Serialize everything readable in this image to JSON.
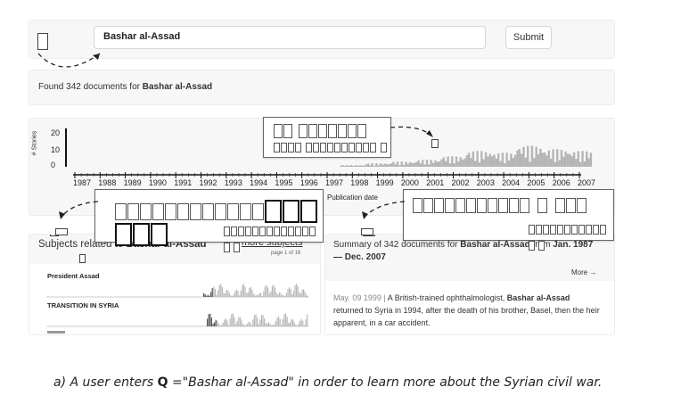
{
  "search": {
    "query": "Bashar al-Assad",
    "submit_label": "Submit"
  },
  "found": {
    "prefix": "Found 342 documents for ",
    "query": "Bashar al-Assad"
  },
  "timeline": {
    "y_label": "# Stories",
    "y_ticks": [
      "20",
      "10",
      "0"
    ],
    "x_label": "Publication date"
  },
  "chart_data": {
    "type": "area",
    "ylabel": "# Stories",
    "xlabel": "Publication date",
    "x": [
      "1987",
      "1988",
      "1989",
      "1990",
      "1991",
      "1992",
      "1993",
      "1994",
      "1995",
      "1996",
      "1997",
      "1998",
      "1999",
      "2000",
      "2001",
      "2002",
      "2003",
      "2004",
      "2005",
      "2006",
      "2007"
    ],
    "values": [
      0,
      0,
      0,
      0,
      0,
      0,
      0,
      0,
      0,
      0,
      0,
      1,
      2,
      3,
      4,
      6,
      9,
      8,
      12,
      10,
      9
    ],
    "ylim": [
      0,
      25
    ],
    "grid": false
  },
  "subjects": {
    "heading_prefix": "Subjects related to ",
    "heading_query": "Bashar al-Assad",
    "more_label": "more subjects",
    "page_info": "page 1 of 16",
    "items": [
      "President Assad",
      "TRANSITION IN SYRIA"
    ]
  },
  "summary": {
    "prefix": "Summary of 342 documents for ",
    "query": "Bashar al-Assad",
    "range_prefix": " from ",
    "range": "Jan. 1987 — Dec. 2007",
    "more_label": "More →",
    "doc": {
      "date": "May. 09 1999",
      "sep": " | ",
      "text": "A British-trained ophthalmologist, ",
      "bold": "Bashar al-Assad",
      "rest": " returned to Syria in 1994, after the death of his brother, Basel, then the heir apparent, in a car accident."
    }
  },
  "caption": {
    "lead": "a)  A user enters ",
    "q": "Q",
    "text": " =\"Bashar al-Assad\" in order to learn more about the Syrian civil war."
  },
  "colors": {
    "panel": "#f7f7f7",
    "spark": "#b5b5b5",
    "ink": "#222222"
  }
}
